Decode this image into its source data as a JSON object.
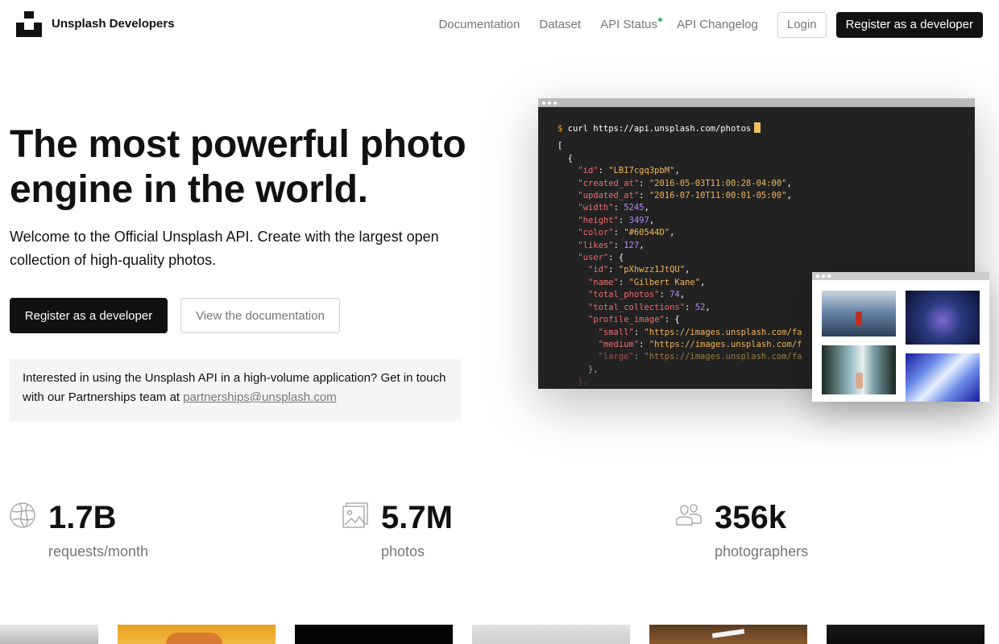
{
  "header": {
    "brand": "Unsplash Developers",
    "nav": [
      "Documentation",
      "Dataset",
      "API Status",
      "API Changelog"
    ],
    "login": "Login",
    "register": "Register as a developer"
  },
  "hero": {
    "title": "The most powerful photo engine in the world.",
    "subtitle": "Welcome to the Official Unsplash API. Create with the largest open collection of high-quality photos.",
    "primary_button": "Register as a developer",
    "secondary_button": "View the documentation",
    "partner_text": "Interested in using the Unsplash API in a high-volume application? Get in touch with our Partnerships team at",
    "partner_email": "partnerships@unsplash.com"
  },
  "terminal": {
    "prompt": "$",
    "command": "curl https://api.unsplash.com/photos",
    "fields": {
      "id": "\"LBI7cgq3pbM\"",
      "created_at": "\"2016-05-03T11:00:28-04:00\"",
      "updated_at": "\"2016-07-10T11:00:01-05:00\"",
      "width": "5245",
      "height": "3497",
      "color": "\"#60544D\"",
      "likes": "127",
      "user_id": "\"pXhwzz1JtQU\"",
      "user_name": "\"Gilbert Kane\"",
      "total_photos": "74",
      "total_collections": "52",
      "small": "\"https://images.unsplash.com/fa",
      "medium": "\"https://images.unsplash.com/f",
      "large": "\"https://images.unsplash.com/fa"
    }
  },
  "stats": [
    {
      "value": "1.7B",
      "label": "requests/month",
      "icon": "globe-icon"
    },
    {
      "value": "5.7M",
      "label": "photos",
      "icon": "photos-icon"
    },
    {
      "value": "356k",
      "label": "photographers",
      "icon": "people-icon"
    }
  ],
  "colors": {
    "accent_dark": "#111111",
    "muted": "#767676",
    "status_green": "#3cb46e",
    "terminal_bg": "#222222"
  }
}
